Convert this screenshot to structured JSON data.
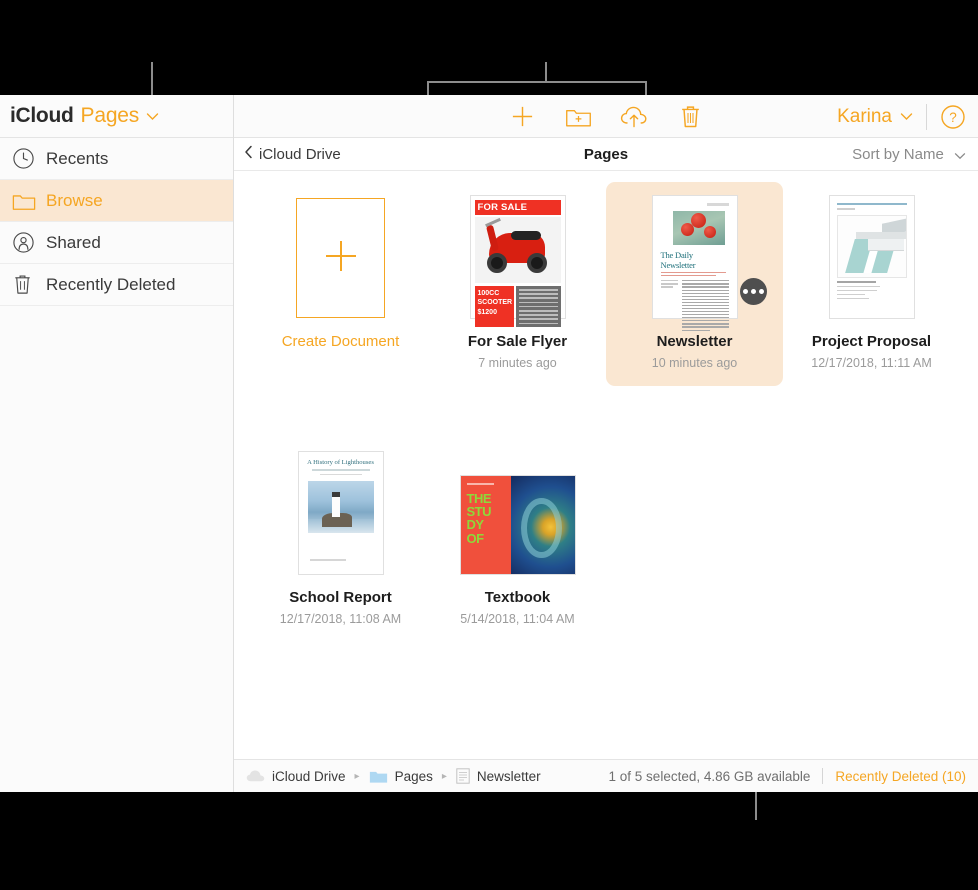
{
  "sidebar": {
    "brand": {
      "icloud": "iCloud",
      "app": "Pages",
      "chevron": "chevron-down-icon"
    },
    "items": [
      {
        "label": "Recents",
        "icon": "clock-icon",
        "active": false
      },
      {
        "label": "Browse",
        "icon": "folder-icon",
        "active": true
      },
      {
        "label": "Shared",
        "icon": "shared-person-icon",
        "active": false
      },
      {
        "label": "Recently Deleted",
        "icon": "trash-icon",
        "active": false
      }
    ]
  },
  "toolbar": {
    "buttons": [
      {
        "name": "new-document-button",
        "icon": "plus-icon"
      },
      {
        "name": "new-folder-button",
        "icon": "folder-plus-icon"
      },
      {
        "name": "upload-button",
        "icon": "cloud-upload-icon"
      },
      {
        "name": "delete-button",
        "icon": "trash-icon"
      }
    ],
    "user": "Karina",
    "user_chevron": "chevron-down-icon",
    "help": "help-question-icon"
  },
  "navbar": {
    "back_label": "iCloud Drive",
    "back_icon": "chevron-left-icon",
    "title": "Pages",
    "sort_label": "Sort by Name",
    "sort_chevron": "chevron-down-icon"
  },
  "grid": {
    "create": {
      "label": "Create Document",
      "icon": "plus-icon"
    },
    "items": [
      {
        "name": "For Sale Flyer",
        "date": "7 minutes ago",
        "selected": false,
        "thumb": "flyer",
        "thumb_text": {
          "band": "FOR SALE",
          "price": "100CC\nSCOOTER\n$1200"
        }
      },
      {
        "name": "Newsletter",
        "date": "10 minutes ago",
        "selected": true,
        "thumb": "newsletter",
        "thumb_text": {
          "headline": "The Daily Newsletter"
        },
        "more_button": "more-options-icon"
      },
      {
        "name": "Project Proposal",
        "date": "12/17/2018, 11:11 AM",
        "selected": false,
        "thumb": "proposal",
        "thumb_text": {
          "caption": "Project Proposal"
        }
      },
      {
        "name": "School Report",
        "date": "12/17/2018, 11:08 AM",
        "selected": false,
        "thumb": "school",
        "thumb_text": {
          "headline": "A History of Lighthouses"
        }
      },
      {
        "name": "Textbook",
        "date": "5/14/2018, 11:04 AM",
        "selected": false,
        "thumb": "textbook",
        "thumb_text": {
          "title": "THE\nSTU\nDY\nOF"
        }
      }
    ]
  },
  "statusbar": {
    "crumbs": [
      {
        "label": "iCloud Drive",
        "icon": "cloud-icon"
      },
      {
        "label": "Pages",
        "icon": "folder-icon"
      },
      {
        "label": "Newsletter",
        "icon": "document-icon"
      }
    ],
    "separator": "▸",
    "info": "1 of 5 selected, 4.86 GB available",
    "link": "Recently Deleted (10)"
  },
  "colors": {
    "accent": "#f5a623",
    "selection_bg": "#fae7d2",
    "callout": "#8c8c8c",
    "backdrop": "#000000"
  }
}
